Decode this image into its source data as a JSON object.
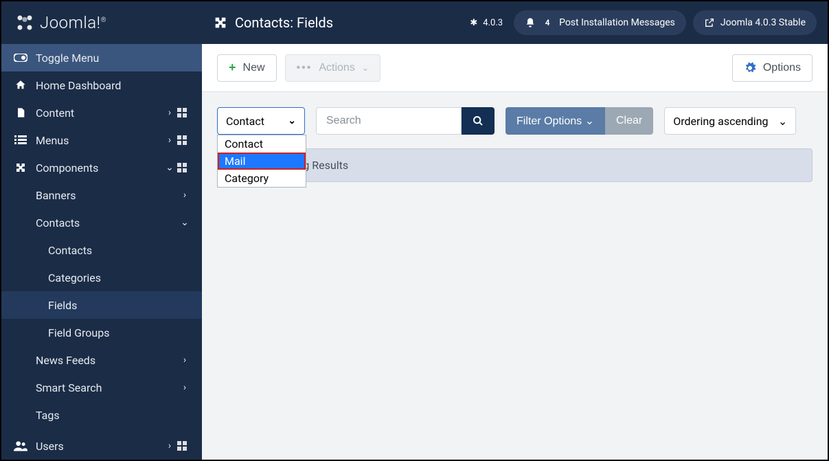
{
  "brand": {
    "name": "Joomla!",
    "sup": "®"
  },
  "sidebar": {
    "toggle_label": "Toggle Menu",
    "home_label": "Home Dashboard",
    "content_label": "Content",
    "menus_label": "Menus",
    "components_label": "Components",
    "banners_label": "Banners",
    "contacts_parent_label": "Contacts",
    "contacts_label": "Contacts",
    "categories_label": "Categories",
    "fields_label": "Fields",
    "field_groups_label": "Field Groups",
    "news_feeds_label": "News Feeds",
    "smart_search_label": "Smart Search",
    "tags_label": "Tags",
    "users_label": "Users"
  },
  "topbar": {
    "title": "Contacts: Fields",
    "version_short": "4.0.3",
    "notif_count": "4",
    "post_install": "Post Installation Messages",
    "stable_label": "Joomla 4.0.3 Stable"
  },
  "toolbar": {
    "new_label": "New",
    "actions_label": "Actions",
    "options_label": "Options"
  },
  "filters": {
    "select_value": "Contact",
    "options": [
      "Contact",
      "Mail",
      "Category"
    ],
    "search_placeholder": "Search",
    "filter_options_label": "Filter Options",
    "clear_label": "Clear",
    "order_label": "Ordering ascending"
  },
  "results": {
    "no_match": "No Matching Results"
  }
}
